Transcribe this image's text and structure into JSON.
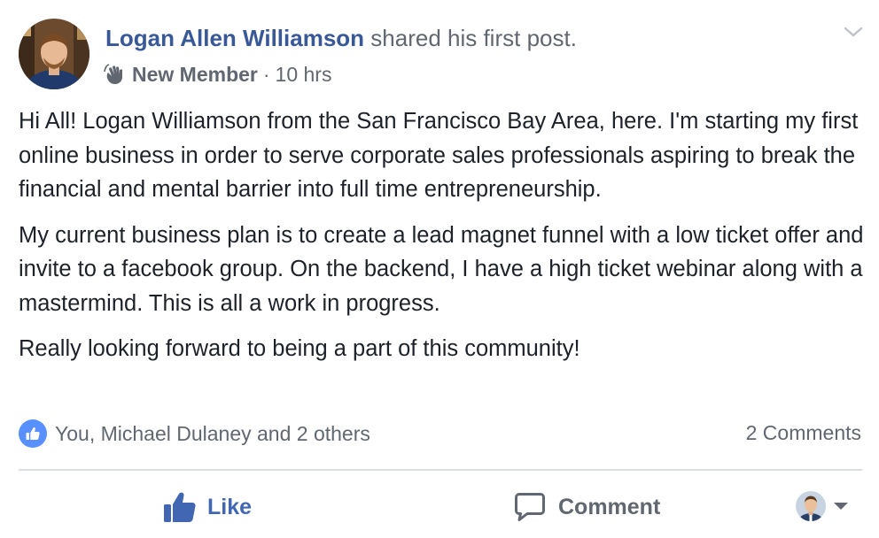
{
  "post": {
    "author": "Logan Allen Williamson",
    "action": "shared his first post.",
    "badge_label": "New Member",
    "badge_icon": "wave-hand-icon",
    "separator": "·",
    "timestamp": "10 hrs",
    "paragraphs": [
      "Hi All! Logan Williamson from the San Francisco Bay Area, here. I'm starting my first online business in order to serve corporate sales professionals aspiring to break the financial and mental barrier into full time entrepreneurship.",
      "My current business plan is to create a lead magnet funnel with a low ticket offer and invite to a facebook group. On the backend, I have a high ticket webinar along with a mastermind. This is all a work in progress.",
      "Really looking forward to being a part of this community!"
    ]
  },
  "reactions": {
    "summary": "You, Michael Dulaney and 2 others",
    "comments_count": "2 Comments"
  },
  "actions": {
    "like_label": "Like",
    "comment_label": "Comment"
  },
  "colors": {
    "link_blue": "#385898",
    "like_blue": "#4267b2",
    "reaction_blue": "#5890ff",
    "muted_text": "#606770",
    "body_text": "#1d2129",
    "divider": "#dadde1"
  }
}
